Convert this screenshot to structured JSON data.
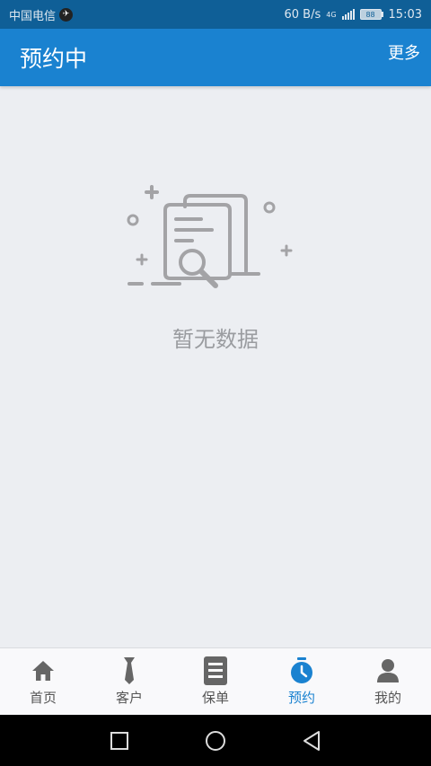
{
  "status_bar": {
    "carrier": "中国电信",
    "speed": "60 B/s",
    "network": "4G",
    "battery": "88",
    "time": "15:03"
  },
  "header": {
    "title": "预约中",
    "more_label": "更多"
  },
  "empty": {
    "message": "暂无数据",
    "icon": "document-search-icon"
  },
  "tabs": [
    {
      "label": "首页",
      "icon": "home-icon"
    },
    {
      "label": "客户",
      "icon": "tie-icon"
    },
    {
      "label": "保单",
      "icon": "policy-icon"
    },
    {
      "label": "预约",
      "icon": "clock-icon"
    },
    {
      "label": "我的",
      "icon": "user-icon"
    }
  ],
  "active_tab": "预约",
  "colors": {
    "status_bar": "#0F5F97",
    "app_bar": "#1A82D0",
    "accent": "#1A82D0",
    "background": "#ECEEF2",
    "tab_icon": "#666666"
  }
}
